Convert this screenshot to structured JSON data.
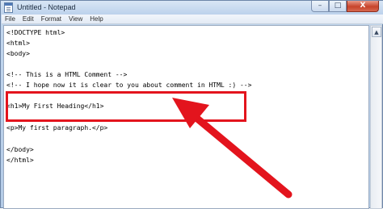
{
  "window": {
    "title": "Untitled - Notepad",
    "caption_buttons": {
      "minimize": "–",
      "maximize": "□",
      "close": "X"
    }
  },
  "menu": [
    "File",
    "Edit",
    "Format",
    "View",
    "Help"
  ],
  "editor": {
    "lines": [
      "<!DOCTYPE html>",
      "<html>",
      "<body>",
      "",
      "<!-- This is a HTML Comment -->",
      "<!-- I hope now it is clear to you about comment in HTML :) -->",
      "",
      "<h1>My First Heading</h1>",
      "",
      "<p>My first paragraph.</p>",
      "",
      "</body>",
      "</html>"
    ]
  },
  "scrollbar": {
    "up_arrow": "▲"
  },
  "annotation": {
    "color": "#e3141d"
  }
}
